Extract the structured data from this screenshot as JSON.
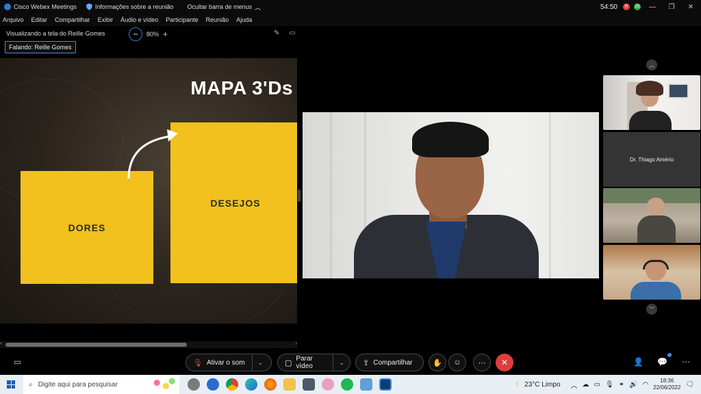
{
  "titlebar": {
    "app_title": "Cisco Webex Meetings",
    "meeting_info": "Informações sobre a reunião",
    "hide_menu": "Ocultar barra de menus",
    "timer": "54:50",
    "badge_red": "R",
    "badge_green": "JS"
  },
  "menu": {
    "items": [
      "Arquivo",
      "Editar",
      "Compartilhar",
      "Exibir",
      "Áudio e vídeo",
      "Participante",
      "Reunião",
      "Ajuda"
    ]
  },
  "share": {
    "viewing_label": "Visualizando a tela do Reille Gomes",
    "zoom_level": "80%",
    "speaking_label": "Falando: Reille Gomes"
  },
  "slide": {
    "title": "MAPA 3'Ds",
    "box_left": "DORES",
    "box_right": "DESEJOS"
  },
  "participants": {
    "tile2_name": "Dr. Thiago Amério"
  },
  "controls": {
    "mute_label": "Ativar o som",
    "video_label": "Parar vídeo",
    "share_label": "Compartilhar"
  },
  "taskbar": {
    "search_placeholder": "Digite aqui para pesquisar",
    "weather": "23°C  Limpo",
    "time": "18:36",
    "date": "22/06/2022"
  },
  "colors": {
    "slide_yellow": "#f2c11e",
    "end_call_red": "#e03c3c",
    "accent_blue": "#3a78c8"
  }
}
